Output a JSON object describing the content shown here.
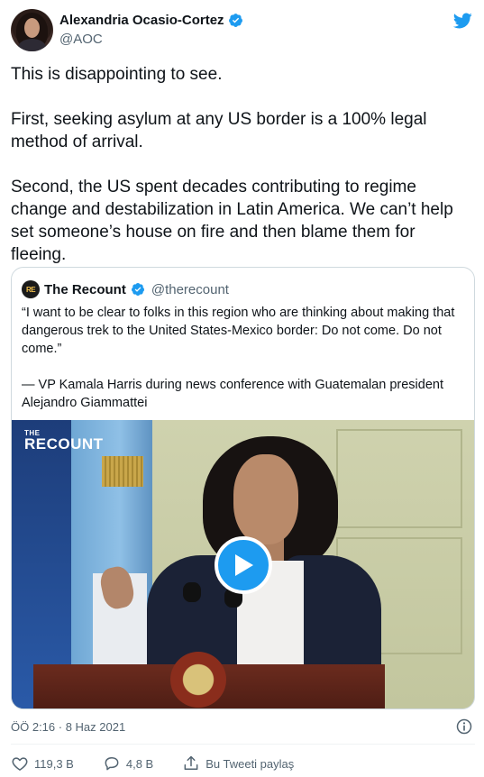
{
  "author": {
    "name": "Alexandria Ocasio-Cortez",
    "handle": "@AOC"
  },
  "tweet": {
    "paragraphs": [
      "This is disappointing to see.",
      "First, seeking asylum at any US border is a 100% legal method of arrival.",
      "Second, the US spent decades contributing to regime change and destabilization in Latin America. We can’t help set someone’s house on fire and then blame them for fleeing."
    ]
  },
  "quote": {
    "logo_text": "RE",
    "name": "The Recount",
    "handle": "@therecount",
    "paragraphs": [
      "“I want to be clear to folks in this region who are thinking about making that dangerous trek to the United States-Mexico border: Do not come. Do not come.”",
      "— VP Kamala Harris during news conference with Guatemalan president Alejandro Giammattei"
    ],
    "media": {
      "watermark_small": "THE",
      "watermark_large": "RECOUNT"
    }
  },
  "meta": {
    "timestamp": "ÖÖ 2:16 · 8 Haz 2021"
  },
  "actions": {
    "likes": "119,3 B",
    "replies": "4,8 B",
    "share_label": "Bu Tweeti paylaş"
  },
  "colors": {
    "accent": "#1d9bf0",
    "text": "#0f1419",
    "secondary": "#536471",
    "border": "#cfd9de"
  }
}
